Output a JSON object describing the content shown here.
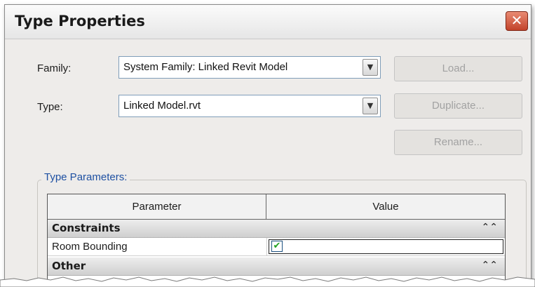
{
  "window": {
    "title": "Type Properties",
    "close_glyph": "✕"
  },
  "form": {
    "family_label": "Family:",
    "family_value": "System Family: Linked Revit Model",
    "type_label": "Type:",
    "type_value": "Linked Model.rvt",
    "dropdown_glyph": "▼"
  },
  "buttons": {
    "load": "Load...",
    "duplicate": "Duplicate...",
    "rename": "Rename..."
  },
  "type_parameters": {
    "legend": "Type Parameters:",
    "columns": {
      "parameter": "Parameter",
      "value": "Value"
    },
    "groups": [
      {
        "name": "Constraints",
        "collapse_glyph": "⌃⌃"
      },
      {
        "name": "Other",
        "collapse_glyph": "⌃⌃"
      }
    ],
    "rows": [
      {
        "parameter": "Room Bounding",
        "checked": true,
        "check_glyph": "✔"
      }
    ]
  },
  "colors": {
    "legend_text": "#1e50a2",
    "checkmark": "#21a121",
    "close_button": "#c2422a"
  }
}
